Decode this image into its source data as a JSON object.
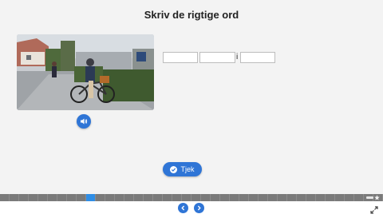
{
  "exercise": {
    "title": "Skriv de rigtige ord",
    "photo_description": "",
    "blanks": [
      {
        "value": "",
        "placeholder": ""
      },
      {
        "value": "",
        "placeholder": ""
      },
      {
        "value": "",
        "placeholder": ""
      }
    ],
    "inline_word": "i"
  },
  "buttons": {
    "audio_icon": "speaker-icon",
    "check_label": "Tjek",
    "check_icon": "checkmark-icon"
  },
  "progress": {
    "total_steps": 40,
    "current_step": 10
  },
  "nav": {
    "prev_icon": "chevron-left-icon",
    "next_icon": "chevron-right-icon",
    "fullscreen_icon": "expand-icon"
  },
  "colors": {
    "accent": "#2f75d6",
    "progress_active": "#2f8ee6",
    "progress_bg": "#7a7a7a",
    "stage_bg": "#f3f3f3"
  }
}
